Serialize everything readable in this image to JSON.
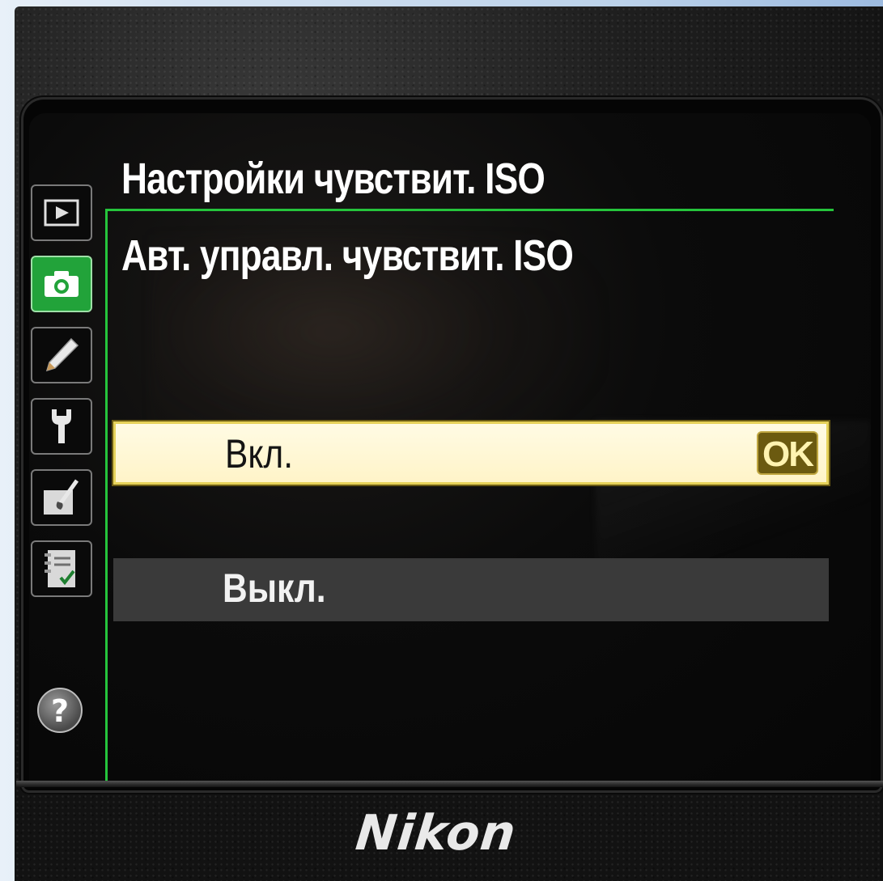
{
  "menu": {
    "title": "Настройки чувствит. ISO",
    "setting": "Авт. управл. чувствит. ISO"
  },
  "side_tabs": [
    {
      "name": "playback-menu",
      "icon": "play-icon",
      "active": false
    },
    {
      "name": "shooting-menu",
      "icon": "camera-icon",
      "active": true
    },
    {
      "name": "custom-settings-menu",
      "icon": "pencil-icon",
      "active": false
    },
    {
      "name": "setup-menu",
      "icon": "wrench-icon",
      "active": false
    },
    {
      "name": "retouch-menu",
      "icon": "brush-icon",
      "active": false
    },
    {
      "name": "recent-settings-menu",
      "icon": "checklist-icon",
      "active": false
    }
  ],
  "help": {
    "label": "?"
  },
  "options": {
    "on": {
      "label": "Вкл.",
      "selected": true,
      "badge": "OK"
    },
    "off": {
      "label": "Выкл.",
      "selected": false
    }
  },
  "brand": "Nikon",
  "colors": {
    "accent_green": "#25c43c",
    "selected_bg": "#fffbe4",
    "ok_badge": "#6b5a10",
    "unselected_bg": "#3a3a3a"
  }
}
